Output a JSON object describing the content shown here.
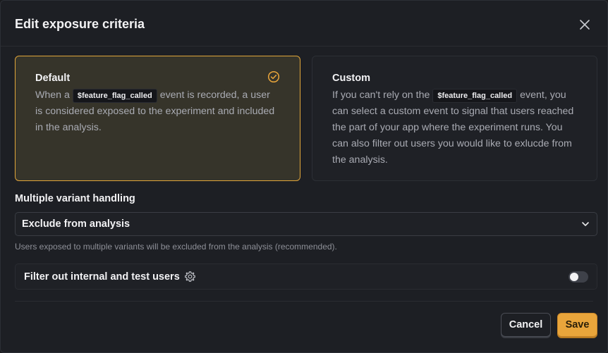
{
  "modal": {
    "title": "Edit exposure criteria"
  },
  "cards": {
    "default": {
      "title": "Default",
      "text_before": "When a",
      "code": "$feature_flag_called",
      "text_after": "event is recorded, a user is considered exposed to the experiment and included in the analysis.",
      "selected": true
    },
    "custom": {
      "title": "Custom",
      "text_before": "If you can't rely on the",
      "code": "$feature_flag_called",
      "text_after": "event, you can select a custom event to signal that users reached the part of your app where the experiment runs. You can also filter out users you would like to exlucde from the analysis.",
      "selected": false
    }
  },
  "variant_handling": {
    "label": "Multiple variant handling",
    "selected": "Exclude from analysis",
    "hint": "Users exposed to multiple variants will be excluded from the analysis (recommended)."
  },
  "filter": {
    "label": "Filter out internal and test users",
    "enabled": false
  },
  "footer": {
    "cancel_label": "Cancel",
    "save_label": "Save"
  },
  "colors": {
    "accent": "#e9a53b",
    "background": "#1d1f24",
    "selected_card_bg": "#36342a"
  },
  "icons": {
    "close": "close-icon",
    "check": "check-circle-icon",
    "chevron": "chevron-down-icon",
    "gear": "gear-icon"
  }
}
